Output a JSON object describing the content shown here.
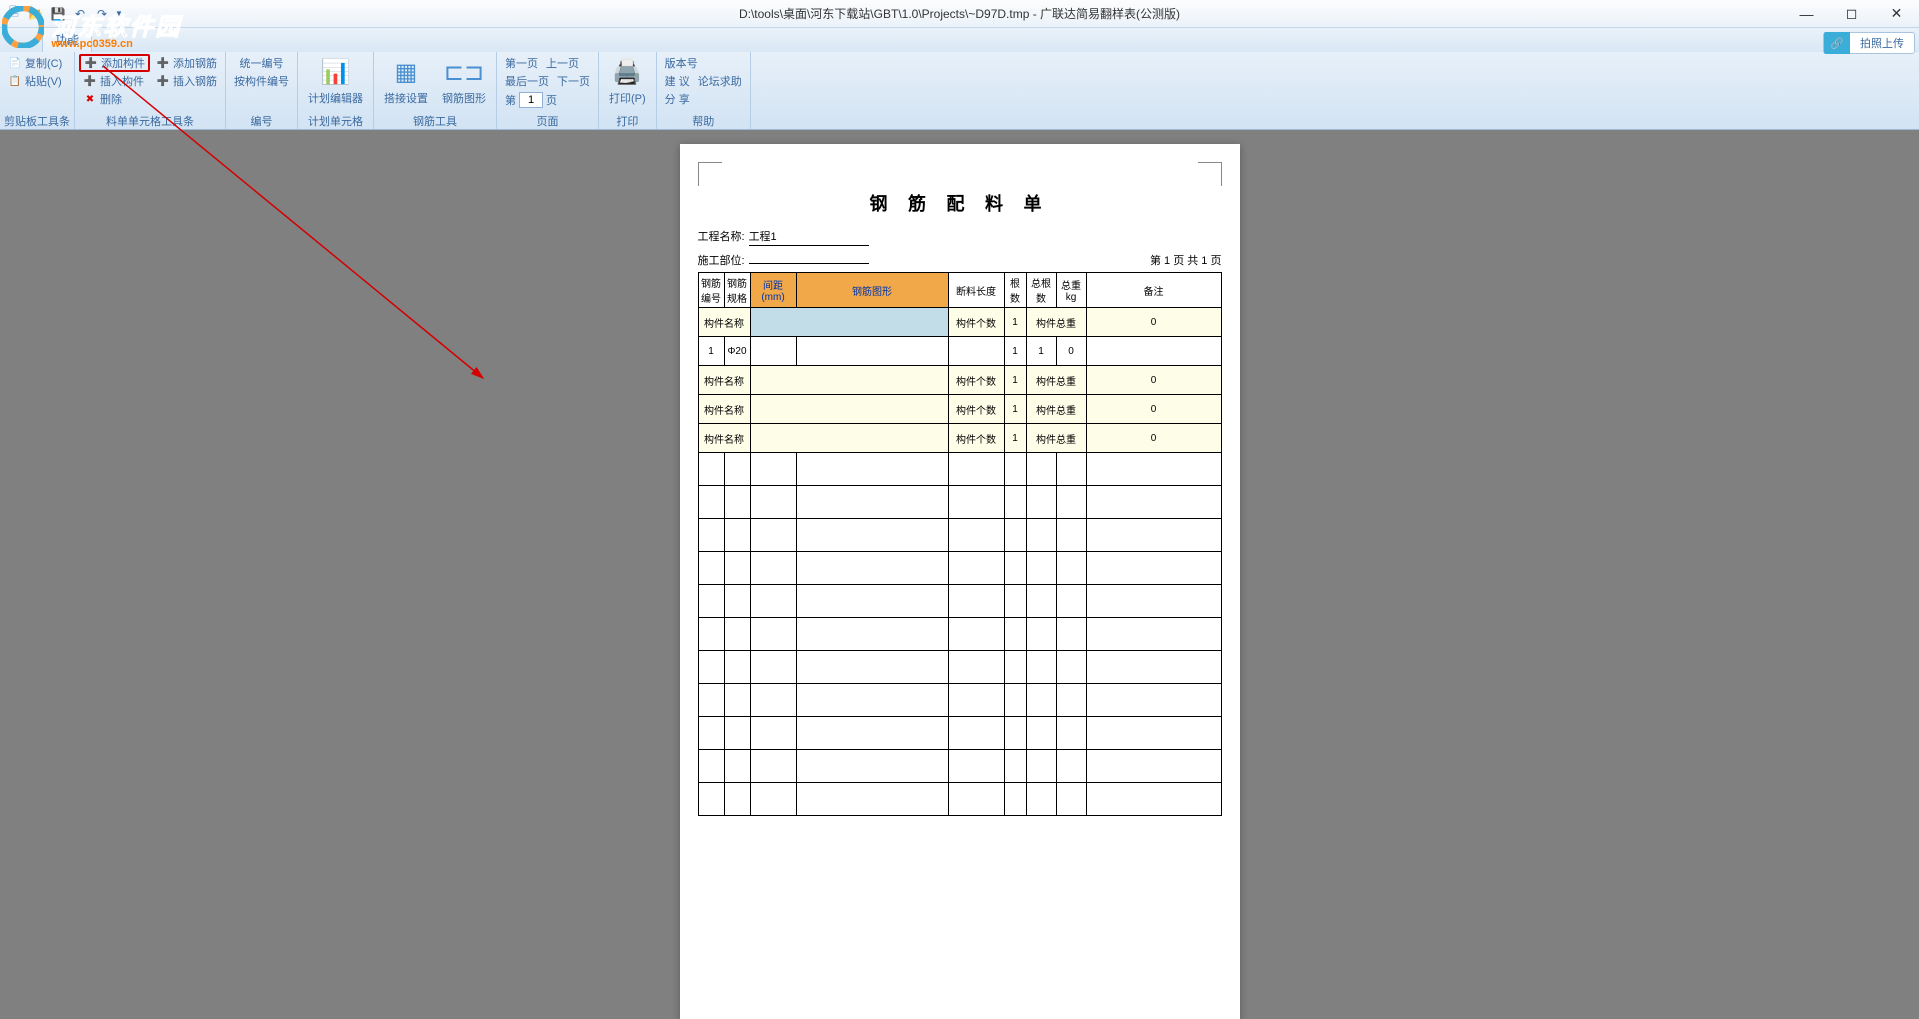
{
  "window": {
    "title": "D:\\tools\\桌面\\河东下载站\\GBT\\1.0\\Projects\\~D97D.tmp - 广联达简易翻样表(公测版)"
  },
  "watermark": {
    "main": "河东软件园",
    "url": "www.pc0359.cn"
  },
  "upload": {
    "label": "拍照上传"
  },
  "ribbon": {
    "tab": "功能",
    "groups": {
      "clipboard": {
        "label": "剪贴板工具条",
        "copy": "复制(C)",
        "paste": "粘贴(V)"
      },
      "component": {
        "label": "料单单元格工具条",
        "add_component": "添加构件",
        "insert_component": "插入构件",
        "delete": "删除",
        "add_rebar": "添加钢筋",
        "insert_rebar": "插入钢筋"
      },
      "numbering": {
        "label": "编号",
        "unified": "统一编号",
        "by_component": "按构件编号"
      },
      "plan": {
        "label": "计划单元格",
        "editor": "计划编辑器"
      },
      "rebar_tools": {
        "label": "钢筋工具",
        "splice": "搭接设置",
        "shape": "钢筋图形"
      },
      "page": {
        "label": "页面",
        "first": "第一页",
        "prev": "上一页",
        "last": "最后一页",
        "next": "下一页",
        "di": "第",
        "ye": "页",
        "current": "1"
      },
      "print": {
        "label": "打印",
        "print_btn": "打印(P)"
      },
      "help": {
        "label": "帮助",
        "version": "版本号",
        "suggest": "建 议",
        "forum": "论坛求助",
        "share": "分 享"
      }
    }
  },
  "document": {
    "title": "钢 筋 配 料 单",
    "project_label": "工程名称:",
    "project_value": "工程1",
    "section_label": "施工部位:",
    "section_value": "",
    "page_info": "第 1 页 共 1 页",
    "headers": {
      "bianhao": "钢筋编号",
      "guige": "钢筋规格",
      "jianju": "间距(mm)",
      "tuxing": "钢筋图形",
      "changdu": "断料长度",
      "gen": "根数",
      "zonggen": "总根数",
      "zhong": "总重kg",
      "beizhu": "备注"
    },
    "rows": [
      {
        "type": "active",
        "name_label": "构件名称",
        "count_label": "构件个数",
        "count": "1",
        "weight_label": "构件总重",
        "weight": "0"
      },
      {
        "type": "data",
        "bianhao": "1",
        "guige": "Φ20",
        "jianju": "",
        "tuxing": "",
        "changdu": "",
        "gen": "1",
        "zonggen": "1",
        "zhong": "0",
        "beizhu": ""
      },
      {
        "type": "comp",
        "name_label": "构件名称",
        "count_label": "构件个数",
        "count": "1",
        "weight_label": "构件总重",
        "weight": "0"
      },
      {
        "type": "comp",
        "name_label": "构件名称",
        "count_label": "构件个数",
        "count": "1",
        "weight_label": "构件总重",
        "weight": "0"
      },
      {
        "type": "comp",
        "name_label": "构件名称",
        "count_label": "构件个数",
        "count": "1",
        "weight_label": "构件总重",
        "weight": "0"
      }
    ]
  }
}
